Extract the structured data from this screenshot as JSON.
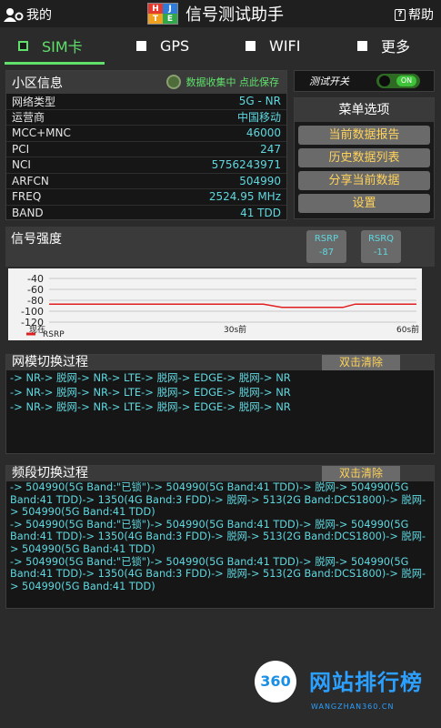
{
  "topbar": {
    "mine_label": "我的",
    "title": "信号测试助手",
    "logo_letters": [
      "H",
      "J",
      "T",
      "E"
    ],
    "help_label": "帮助"
  },
  "tabs": [
    {
      "label": "SIM卡",
      "active": true
    },
    {
      "label": "GPS",
      "active": false
    },
    {
      "label": "WIFI",
      "active": false
    },
    {
      "label": "更多",
      "active": false
    }
  ],
  "cell_info": {
    "title": "小区信息",
    "collect_status": "数据收集中 点此保存",
    "rows": [
      {
        "key": "网络类型",
        "value": "5G - NR"
      },
      {
        "key": "运营商",
        "value": "中国移动"
      },
      {
        "key": "MCC+MNC",
        "value": "46000"
      },
      {
        "key": "PCI",
        "value": "247"
      },
      {
        "key": "NCI",
        "value": "5756243971"
      },
      {
        "key": "ARFCN",
        "value": "504990"
      },
      {
        "key": "FREQ",
        "value": "2524.95 MHz"
      },
      {
        "key": "BAND",
        "value": "41 TDD"
      }
    ]
  },
  "test_switch": {
    "label": "测试开关",
    "state": "ON"
  },
  "menu": {
    "title": "菜单选项",
    "items": [
      "当前数据报告",
      "历史数据列表",
      "分享当前数据",
      "设置"
    ]
  },
  "signal": {
    "title": "信号强度",
    "rsrp": {
      "label": "RSRP",
      "value": "-87"
    },
    "rsrq": {
      "label": "RSRQ",
      "value": "-11"
    }
  },
  "chart_data": {
    "type": "line",
    "y_ticks": [
      "-40",
      "-60",
      "-80",
      "-100",
      "-120"
    ],
    "ylim": [
      -120,
      -40
    ],
    "x_labels": [
      "现在",
      "30s前",
      "60s前"
    ],
    "series": [
      {
        "name": "RSRP",
        "color": "#e02020",
        "x": [
          0,
          5,
          10,
          15,
          20,
          25,
          30,
          35,
          38,
          42,
          45,
          48,
          50,
          55,
          60
        ],
        "values": [
          -87,
          -87,
          -87,
          -87,
          -87,
          -87,
          -87,
          -87,
          -93,
          -93,
          -93,
          -93,
          -87,
          -87,
          -87
        ]
      }
    ],
    "grid": true,
    "legend": "bottom-left"
  },
  "mode_switch": {
    "title": "网模切换过程",
    "clear_label": "双击清除",
    "lines": [
      "-> NR-> 脱网-> NR-> LTE-> 脱网-> EDGE-> 脱网-> NR",
      "-> NR-> 脱网-> NR-> LTE-> 脱网-> EDGE-> 脱网-> NR",
      "-> NR-> 脱网-> NR-> LTE-> 脱网-> EDGE-> 脱网-> NR"
    ]
  },
  "band_switch": {
    "title": "频段切换过程",
    "clear_label": "双击清除",
    "lines": [
      "-> 504990(5G Band:\"已锁\")-> 504990(5G Band:41 TDD)-> 脱网-> 504990(5G Band:41 TDD)-> 1350(4G Band:3 FDD)-> 脱网-> 513(2G Band:DCS1800)-> 脱网-> 504990(5G Band:41 TDD)",
      "-> 504990(5G Band:\"已锁\")-> 504990(5G Band:41 TDD)-> 脱网-> 504990(5G Band:41 TDD)-> 1350(4G Band:3 FDD)-> 脱网-> 513(2G Band:DCS1800)-> 脱网-> 504990(5G Band:41 TDD)",
      "-> 504990(5G Band:\"已锁\")-> 504990(5G Band:41 TDD)-> 脱网-> 504990(5G Band:41 TDD)-> 1350(4G Band:3 FDD)-> 脱网-> 513(2G Band:DCS1800)-> 脱网-> 504990(5G Band:41 TDD)"
    ]
  },
  "watermark": {
    "logo": "360",
    "text": "网站排行榜",
    "sub": "WANGZHAN360.CN"
  }
}
